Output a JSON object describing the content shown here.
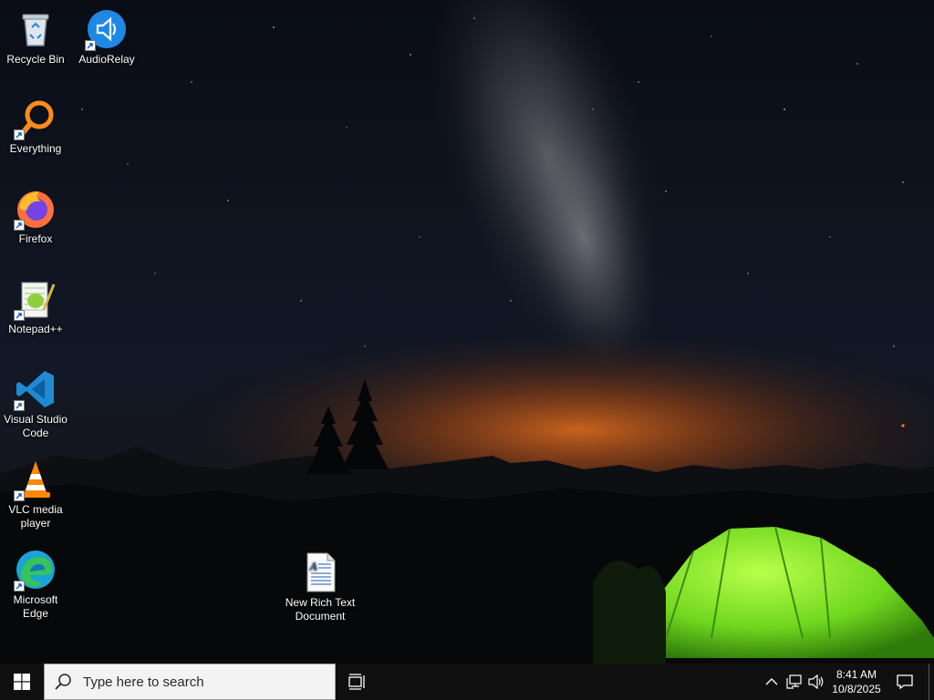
{
  "desktop": {
    "icons": [
      {
        "label": "Recycle Bin"
      },
      {
        "label": "AudioRelay"
      },
      {
        "label": "Everything"
      },
      {
        "label": "Firefox"
      },
      {
        "label": "Notepad++"
      },
      {
        "label": "Visual Studio Code"
      },
      {
        "label": "VLC media player"
      },
      {
        "label": "Microsoft Edge"
      },
      {
        "label": "New Rich Text Document"
      }
    ]
  },
  "taskbar": {
    "search_placeholder": "Type here to search",
    "clock": {
      "time": "8:41 AM",
      "date": "10/8/2025"
    },
    "tray_icons": [
      "chevron-up-icon",
      "network-icon",
      "volume-icon",
      "notification-icon"
    ],
    "accent_color": "#101010"
  }
}
